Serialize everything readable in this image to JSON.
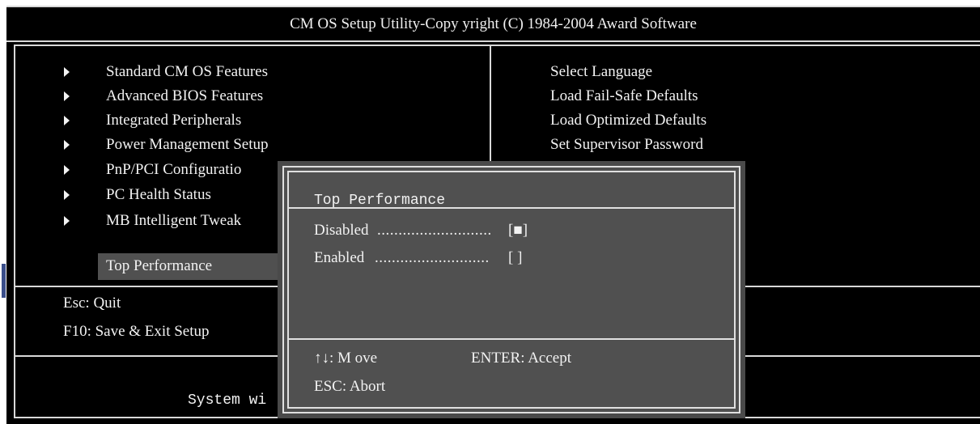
{
  "header": {
    "title": "CM OS Setup Utility-Copy yright (C) 1984-2004 Award Software"
  },
  "left_menu": [
    {
      "label": "Standard CM OS Features"
    },
    {
      "label": "Advanced BIOS Features"
    },
    {
      "label": "Integrated Peripherals"
    },
    {
      "label": "Power Management Setup"
    },
    {
      "label": "PnP/PCI Configuratio"
    },
    {
      "label": "PC Health Status"
    },
    {
      "label": "MB Intelligent Tweak"
    },
    {
      "label": "Top Performance"
    }
  ],
  "right_menu": [
    {
      "label": "Select Language"
    },
    {
      "label": "Load Fail-Safe Defaults"
    },
    {
      "label": "Load Optimized Defaults"
    },
    {
      "label": "Set Supervisor Password"
    }
  ],
  "footer_keys": {
    "quit": "Esc: Quit",
    "save_exit": "F10:  Save & Exit Setup"
  },
  "status_line": "System wi",
  "dialog": {
    "title": "Top Performance",
    "options": [
      {
        "label": "Disabled",
        "leader": "...........................",
        "mark": "[■]",
        "selected": true
      },
      {
        "label": "Enabled",
        "leader": "...........................",
        "mark": "[ ]",
        "selected": false
      }
    ],
    "hints": {
      "move": "↑↓: M ove",
      "accept": "ENTER: Accept",
      "abort": "ESC: Abort"
    }
  },
  "colors": {
    "background": "#000000",
    "dialog": "#505050",
    "highlight": "#505050",
    "text": "#f2f2f2"
  }
}
